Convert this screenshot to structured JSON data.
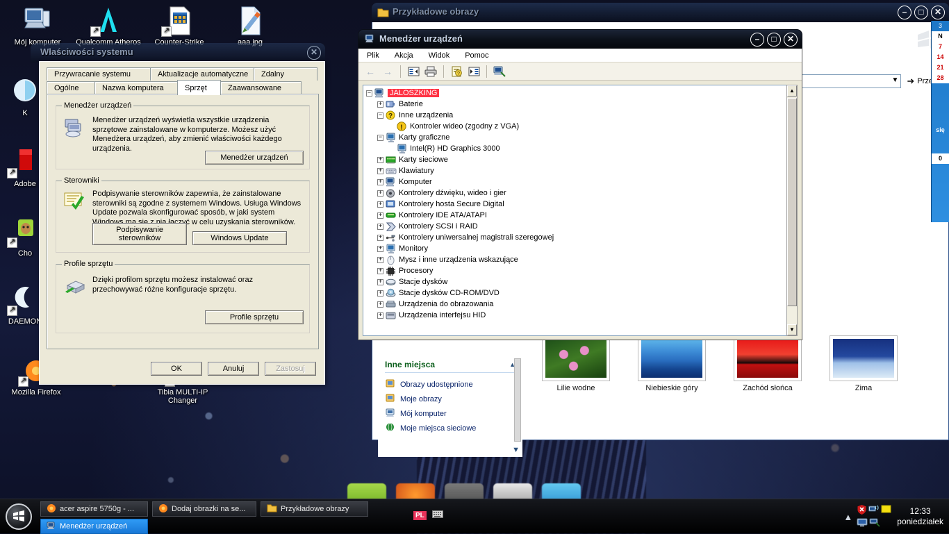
{
  "desktop": {
    "icons_top": [
      {
        "label": "Mój komputer",
        "icon": "my-computer-icon",
        "shortcut": false
      },
      {
        "label": "Qualcomm Atheros",
        "icon": "qualcomm-atheros-icon",
        "shortcut": true
      },
      {
        "label": "Counter-Strike",
        "icon": "counter-strike-icon",
        "shortcut": true
      },
      {
        "label": "aaa.jpg",
        "icon": "paint-image-file-icon",
        "shortcut": false
      }
    ],
    "icons_left": [
      {
        "label": "K",
        "icon": "kaspersky-icon",
        "shortcut": false
      },
      {
        "label": "Adobe",
        "icon": "adobe-reader-icon",
        "shortcut": true
      },
      {
        "label": "Cho",
        "icon": "chomikuj-icon",
        "shortcut": true
      },
      {
        "label": "DAEMON",
        "icon": "daemon-tools-icon",
        "shortcut": true
      },
      {
        "label": "Mozilla Firefox",
        "icon": "firefox-icon",
        "shortcut": true
      }
    ],
    "icons_bottom": [
      {
        "label": "Tibia MULTI-IP Changer",
        "icon": "tibia-icon",
        "shortcut": true
      }
    ]
  },
  "system_properties": {
    "title": "Właściwości systemu",
    "close_label": "✕",
    "tabs_row1": [
      {
        "label": "Przywracanie systemu",
        "selected": false
      },
      {
        "label": "Aktualizacje automatyczne",
        "selected": false
      },
      {
        "label": "Zdalny",
        "selected": false
      }
    ],
    "tabs_row2": [
      {
        "label": "Ogólne",
        "selected": false
      },
      {
        "label": "Nazwa komputera",
        "selected": false
      },
      {
        "label": "Sprzęt",
        "selected": true
      },
      {
        "label": "Zaawansowane",
        "selected": false
      }
    ],
    "group_device_manager": {
      "legend": "Menedżer urządzeń",
      "text": "Menedżer urządzeń wyświetla wszystkie urządzenia sprzętowe zainstalowane w komputerze. Możesz użyć Menedżera urządzeń, aby zmienić właściwości każdego urządzenia.",
      "button": "Menedżer urządzeń"
    },
    "group_drivers": {
      "legend": "Sterowniki",
      "text": "Podpisywanie sterowników zapewnia, że zainstalowane sterowniki są zgodne z systemem Windows. Usługa Windows Update pozwala skonfigurować sposób, w jaki system Windows ma się z nią łączyć w celu uzyskania sterowników.",
      "button_sign": "Podpisywanie sterowników",
      "button_update": "Windows Update"
    },
    "group_profiles": {
      "legend": "Profile sprzętu",
      "text": "Dzięki profilom sprzętu możesz instalować oraz przechowywać różne konfiguracje sprzętu.",
      "button": "Profile sprzętu"
    },
    "footer": {
      "ok": "OK",
      "cancel": "Anuluj",
      "apply": "Zastosuj",
      "apply_disabled": true
    }
  },
  "device_manager": {
    "title": "Menedżer urządzeń",
    "window_icon": "device-manager-icon",
    "buttons": {
      "minimize": "–",
      "maximize": "□",
      "close": "✕"
    },
    "menu": [
      "Plik",
      "Akcja",
      "Widok",
      "Pomoc"
    ],
    "toolbar_icons": [
      "back-arrow-icon",
      "forward-arrow-icon",
      "show-hide-tree-icon",
      "print-icon",
      "properties-icon",
      "details-pane-icon",
      "scan-hardware-icon"
    ],
    "tree": [
      {
        "label": "JALOSZKING",
        "depth": 0,
        "toggle": "minus",
        "icon": "computer-icon",
        "selected": true
      },
      {
        "label": "Baterie",
        "depth": 1,
        "toggle": "plus",
        "icon": "battery-icon",
        "selected": false
      },
      {
        "label": "Inne urządzenia",
        "depth": 1,
        "toggle": "minus",
        "icon": "unknown-device-icon",
        "selected": false
      },
      {
        "label": "Kontroler wideo (zgodny z VGA)",
        "depth": 2,
        "toggle": "none",
        "icon": "warning-device-icon",
        "selected": false
      },
      {
        "label": "Karty graficzne",
        "depth": 1,
        "toggle": "minus",
        "icon": "display-adapter-icon",
        "selected": false
      },
      {
        "label": "Intel(R) HD Graphics 3000",
        "depth": 2,
        "toggle": "none",
        "icon": "display-adapter-icon",
        "selected": false
      },
      {
        "label": "Karty sieciowe",
        "depth": 1,
        "toggle": "plus",
        "icon": "network-adapter-icon",
        "selected": false
      },
      {
        "label": "Klawiatury",
        "depth": 1,
        "toggle": "plus",
        "icon": "keyboard-icon",
        "selected": false
      },
      {
        "label": "Komputer",
        "depth": 1,
        "toggle": "plus",
        "icon": "computer-icon",
        "selected": false
      },
      {
        "label": "Kontrolery dźwięku, wideo i gier",
        "depth": 1,
        "toggle": "plus",
        "icon": "sound-controller-icon",
        "selected": false
      },
      {
        "label": "Kontrolery hosta Secure Digital",
        "depth": 1,
        "toggle": "plus",
        "icon": "sd-host-icon",
        "selected": false
      },
      {
        "label": "Kontrolery IDE ATA/ATAPI",
        "depth": 1,
        "toggle": "plus",
        "icon": "ide-controller-icon",
        "selected": false
      },
      {
        "label": "Kontrolery SCSI i RAID",
        "depth": 1,
        "toggle": "plus",
        "icon": "scsi-raid-icon",
        "selected": false
      },
      {
        "label": "Kontrolery uniwersalnej magistrali szeregowej",
        "depth": 1,
        "toggle": "plus",
        "icon": "usb-controller-icon",
        "selected": false
      },
      {
        "label": "Monitory",
        "depth": 1,
        "toggle": "plus",
        "icon": "monitor-icon",
        "selected": false
      },
      {
        "label": "Mysz i inne urządzenia wskazujące",
        "depth": 1,
        "toggle": "plus",
        "icon": "mouse-icon",
        "selected": false
      },
      {
        "label": "Procesory",
        "depth": 1,
        "toggle": "plus",
        "icon": "processor-icon",
        "selected": false
      },
      {
        "label": "Stacje dysków",
        "depth": 1,
        "toggle": "plus",
        "icon": "disk-drive-icon",
        "selected": false
      },
      {
        "label": "Stacje dysków CD-ROM/DVD",
        "depth": 1,
        "toggle": "plus",
        "icon": "cdrom-icon",
        "selected": false
      },
      {
        "label": "Urządzenia do obrazowania",
        "depth": 1,
        "toggle": "plus",
        "icon": "imaging-device-icon",
        "selected": false
      },
      {
        "label": "Urządzenia interfejsu HID",
        "depth": 1,
        "toggle": "plus",
        "icon": "hid-device-icon",
        "selected": false
      }
    ]
  },
  "explorer": {
    "title": "Przykładowe obrazy",
    "window_icon": "folder-icon",
    "buttons": {
      "minimize": "–",
      "maximize": "□",
      "close": "✕"
    },
    "go_label": "Przejdź",
    "address_value": "",
    "side_panel": {
      "header": "Inne miejsca",
      "collapse_icon": "chevron-up-icon",
      "items": [
        {
          "label": "Obrazy udostępnione",
          "icon": "shared-pictures-icon"
        },
        {
          "label": "Moje obrazy",
          "icon": "my-pictures-icon"
        },
        {
          "label": "Mój komputer",
          "icon": "my-computer-icon"
        },
        {
          "label": "Moje miejsca sieciowe",
          "icon": "network-places-icon"
        }
      ]
    },
    "thumbnails": [
      {
        "label": "Lilie wodne",
        "kind": "waterlilies"
      },
      {
        "label": "Niebieskie góry",
        "kind": "bluehills"
      },
      {
        "label": "Zachód słońca",
        "kind": "sunset"
      },
      {
        "label": "Zima",
        "kind": "winter"
      }
    ]
  },
  "calendar_sidebar": {
    "page_label": "3",
    "next_icon": "chevron-right-icon",
    "header": "N",
    "days": [
      "7",
      "14",
      "21",
      "28"
    ],
    "footer_text": "się",
    "counter": "0"
  },
  "taskbar": {
    "start_icon": "windows-start-icon",
    "buttons_row1": [
      {
        "label": "acer aspire 5750g - ...",
        "icon": "firefox-icon",
        "active": false
      },
      {
        "label": "Dodaj obrazki na se...",
        "icon": "firefox-icon",
        "active": false
      },
      {
        "label": "Przykładowe obrazy",
        "icon": "folder-icon",
        "active": false
      }
    ],
    "buttons_row2": [
      {
        "label": "Menedżer urządzeń",
        "icon": "device-manager-icon",
        "active": true
      }
    ],
    "tray": {
      "expand_icon": "chevron-up-icon",
      "language": "PL",
      "keyboard_icon": "keyboard-icon",
      "icons": [
        "antivirus-shield-icon",
        "network-icon",
        "note-icon",
        "monitor-icon",
        "printer-icon"
      ],
      "time": "12:33",
      "day": "poniedziałek"
    }
  },
  "colors": {
    "xp_face": "#ece9d8",
    "selection_red": "#ff3344",
    "taskbar_active": "#1877d6",
    "side_header_green": "#0c5f1c",
    "link_blue": "#0a246a"
  }
}
